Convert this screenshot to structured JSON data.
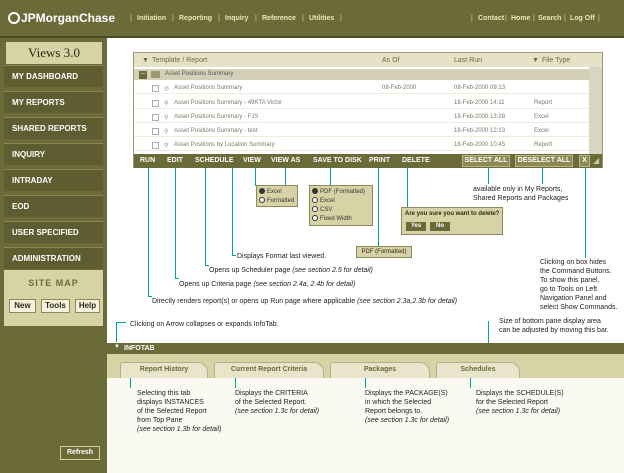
{
  "header": {
    "logo": "JPMorganChase",
    "nav": [
      "Initiation",
      "Reporting",
      "Inquiry",
      "Reference",
      "Utilities"
    ],
    "right_nav": [
      "Contact",
      "Home",
      "Search",
      "Log Off"
    ]
  },
  "sidebar": {
    "views_title": "Views 3.0",
    "items": [
      "MY DASHBOARD",
      "MY REPORTS",
      "SHARED REPORTS",
      "INQUIRY",
      "INTRADAY",
      "EOD",
      "USER SPECIFIED",
      "ADMINISTRATION"
    ],
    "sitemap_title": "SITE MAP",
    "sitemap_buttons": [
      "New",
      "Tools",
      "Help"
    ],
    "refresh_label": "Refresh"
  },
  "table": {
    "columns": [
      "Template / Report",
      "As Of",
      "Last Run",
      "File Type"
    ],
    "group_label": "Asset Positions Summary",
    "rows": [
      {
        "name": "Asset Positions Summary",
        "as_of": "08-Feb-2000",
        "last_run": "08-Feb-2000 09:13",
        "file_type": ""
      },
      {
        "name": "Asset Positions Summary - 49KTA Victor",
        "as_of": "",
        "last_run": "18-Feb-2000 14:11",
        "file_type": "Report"
      },
      {
        "name": "Asset Positions Summary - FJS",
        "as_of": "",
        "last_run": "18-Feb-2000 13:28",
        "file_type": "Excel"
      },
      {
        "name": "Asset Positions Summary - test",
        "as_of": "",
        "last_run": "18-Feb-2000 12:13",
        "file_type": "Excel"
      },
      {
        "name": "Asset Positions by Location Summary",
        "as_of": "",
        "last_run": "18-Feb-2000 10:45",
        "file_type": "Report"
      }
    ]
  },
  "commands": {
    "left": [
      "RUN",
      "EDIT",
      "SCHEDULE",
      "VIEW",
      "VIEW AS",
      "SAVE TO DISK",
      "PRINT",
      "DELETE"
    ],
    "select_all": "SELECT ALL",
    "deselect_all": "DESELECT ALL",
    "close": "X"
  },
  "callouts": {
    "view_as_options": [
      "Excel",
      "Formatted"
    ],
    "save_options": [
      "PDF (Formatted)",
      "Excel",
      "CSV",
      "Fixed Width"
    ],
    "print_label": "PDF (Formatted)",
    "delete_question": "Are you sure you want to delete?",
    "delete_yes": "Yes",
    "delete_no": "No",
    "select_note_1": "available only in My Reports,",
    "select_note_2": "Shared Reports and Packages",
    "close_note": [
      "Clicking on box hides",
      "the Command Buttons.",
      "To show this panel,",
      "go to Tools on Left",
      "Navigation Panel and",
      "select Show Commands."
    ],
    "view_note": "Displays Format last viewed.",
    "schedule_note_a": "Opens up Scheduler page ",
    "schedule_note_b": "(see section 2.5 for detail)",
    "edit_note_a": "Opens up Criteria page ",
    "edit_note_b": "(see section 2.4a, 2.4b for detail)",
    "run_note_a": "Directly renders report(s) or opens up Run page where applicable ",
    "run_note_b": "(see section 2.3a,2.3b for detail)",
    "arrow_note": "Clicking on Arrow collapses or expands InfoTab.",
    "size_note_1": "Size of bottom pane display area",
    "size_note_2": "can be adjusted by moving this bar."
  },
  "infotab": {
    "label": "INFOTAB",
    "tabs": [
      "Report History",
      "Current Report Criteria",
      "Packages",
      "Schedules"
    ],
    "tab_text": [
      [
        "Selecting this tab",
        "displays INSTANCES",
        "of the Selected Report",
        "from Top Pane"
      ],
      [
        "Displays the CRITERIA",
        "of the Selected Report."
      ],
      [
        "Displays the PACKAGE(S)",
        "in which the Selected",
        "Report belongs to."
      ],
      [
        "Displays the SCHEDULE(S)",
        "for the Selected Report"
      ]
    ],
    "tab_refs": [
      "(see section 1.3b for detail)",
      "(see section 1.3c for detail)",
      "(see section 1.3c for detail)",
      "(see section 1.3c for detail)"
    ]
  }
}
